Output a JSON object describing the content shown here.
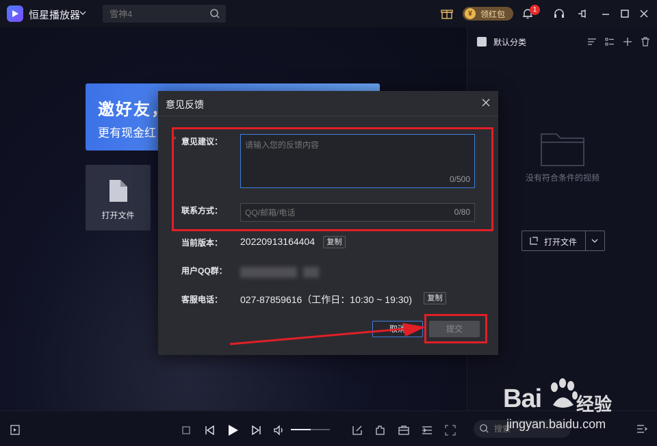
{
  "app": {
    "title": "恒星播放器",
    "search_placeholder": "雪神4",
    "hongbao_label": "领红包",
    "hongbao_coin": "¥",
    "notification_count": "1"
  },
  "banner": {
    "title": "邀好友，",
    "subtitle": "更有现金红"
  },
  "open_card": {
    "label": "打开文件"
  },
  "panel": {
    "title": "默认分类",
    "empty_text": "没有符合条件的视频",
    "open_button": "打开文件"
  },
  "dialog": {
    "title": "意见反馈",
    "required_mark": "*",
    "feedback_label": "意见建议：",
    "feedback_placeholder": "请输入您的反馈内容",
    "feedback_counter": "0/500",
    "contact_label": "联系方式：",
    "contact_placeholder": "QQ/邮箱/电话",
    "contact_counter": "0/80",
    "version_label": "当前版本：",
    "version_value": "20220913164404",
    "qq_label": "用户QQ群：",
    "phone_label": "客服电话：",
    "phone_value": "027-87859616（工作日：10:30 ~ 19:30)",
    "copy_label": "复制",
    "cancel_label": "取消",
    "submit_label": "提交"
  },
  "bottom": {
    "search_placeholder": "搜索",
    "volume_level": 0.5
  },
  "watermark": {
    "brand": "Bai",
    "brand_suffix": "经验",
    "url": "jingyan.baidu.com"
  },
  "colors": {
    "accent": "#3e7ede",
    "annotation_red": "#e11f27",
    "background": "#0c0e1b"
  }
}
